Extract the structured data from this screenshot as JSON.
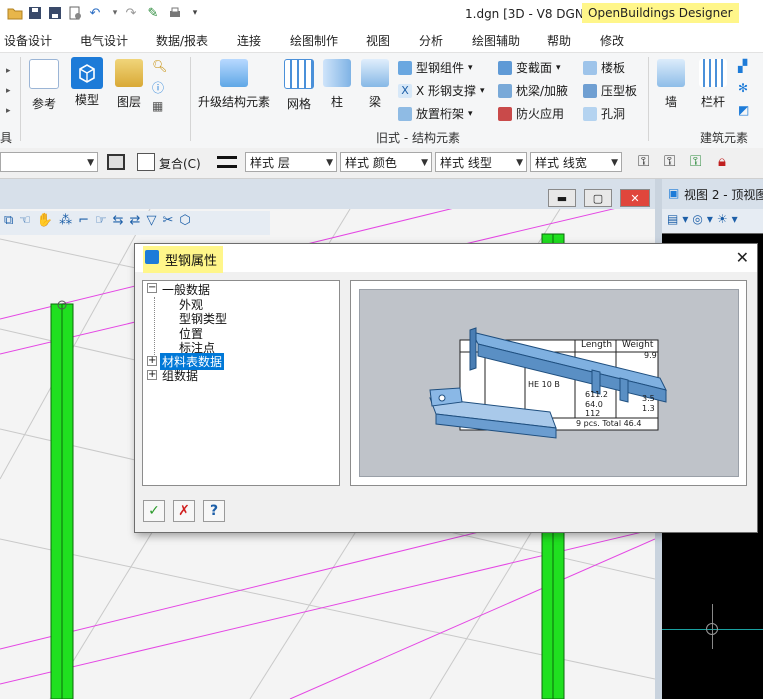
{
  "window": {
    "title": "1.dgn [3D - V8 DGN] -",
    "app_name": "OpenBuildings Designer"
  },
  "menu": [
    "设备设计",
    "电气设计",
    "数据/报表",
    "连接",
    "绘图制作",
    "视图",
    "分析",
    "绘图辅助",
    "帮助",
    "修改"
  ],
  "ribbon": {
    "tools_label": "具",
    "reference_label": "参考",
    "model_label": "模型",
    "level_label": "图层",
    "upgrade_label": "升级结构元素",
    "grid_label": "网格",
    "column_label": "柱",
    "beam_label": "梁",
    "steel_member_label": "型钢组件",
    "x_brace_label": "X 形钢支撑",
    "place_purlin_label": "放置桁架",
    "vary_section_label": "变截面",
    "pillow_beam_label": "枕梁/加腋",
    "fireproof_label": "防火应用",
    "floor_slab_label": "楼板",
    "deck_label": "压型板",
    "opening_label": "孔洞",
    "wall_label": "墙",
    "railing_label": "栏杆",
    "legacy_group_label": "旧式 - 结构元素",
    "building_group_label": "建筑元素"
  },
  "attributes": {
    "composite_label": "复合(C)",
    "style_level": "样式 层",
    "style_color": "样式 颜色",
    "style_linetype": "样式 线型",
    "style_lineweight": "样式 线宽"
  },
  "view2": {
    "title": "视图 2 - 顶视图"
  },
  "dialog": {
    "title": "型钢属性",
    "tree": {
      "general": "一般数据",
      "appearance": "外观",
      "section_type": "型钢类型",
      "position": "位置",
      "label_point": "标注点",
      "bom_data": "材料表数据",
      "group_data": "组数据"
    },
    "preview_table": {
      "header_length": "Length",
      "header_weight": "Weight",
      "row_label": "HE 10 B",
      "total": "9 pcs. Total 46.4",
      "v1": "9.9",
      "v2": "3.5",
      "v3": "1.3",
      "n1": "611.2",
      "n2": "64.0",
      "n3": "112"
    },
    "ok_symbol": "✓",
    "cancel_symbol": "✗",
    "help_symbol": "?"
  },
  "colors": {
    "accent_blue": "#1d7bd8",
    "highlight_yellow": "#fff68a",
    "steel_green": "#1fe01f",
    "selection_blue": "#0078d7"
  }
}
